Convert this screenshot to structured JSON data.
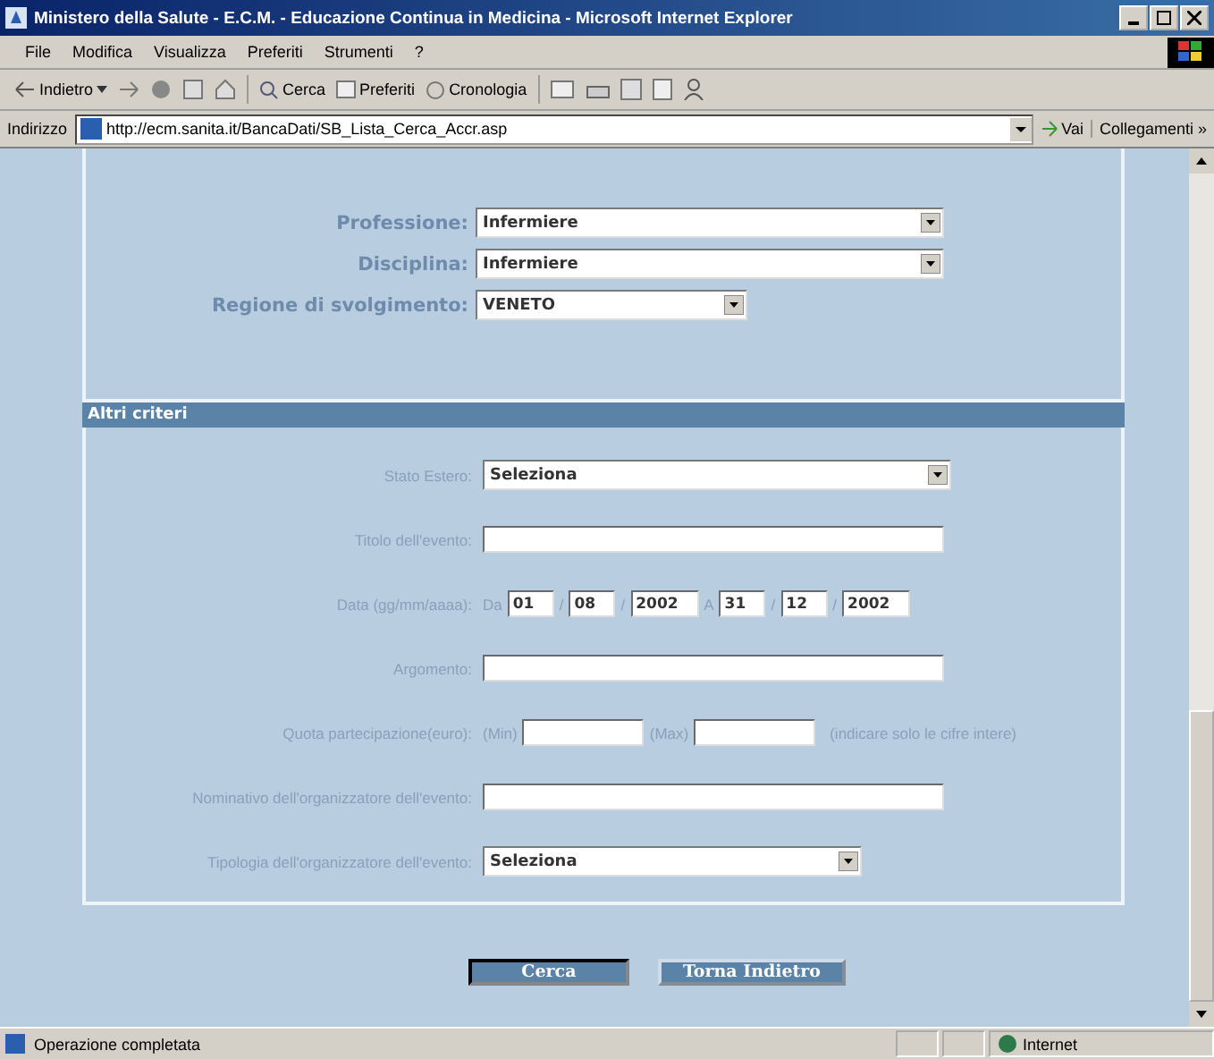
{
  "window": {
    "title": "Ministero della Salute - E.C.M. - Educazione Continua in Medicina - Microsoft Internet Explorer"
  },
  "menu": [
    "File",
    "Modifica",
    "Visualizza",
    "Preferiti",
    "Strumenti",
    "?"
  ],
  "toolbar": {
    "back": "Indietro",
    "search": "Cerca",
    "favorites": "Preferiti",
    "history": "Cronologia"
  },
  "address": {
    "label": "Indirizzo",
    "url": "http://ecm.sanita.it/BancaDati/SB_Lista_Cerca_Accr.asp",
    "go": "Vai",
    "links": "Collegamenti »"
  },
  "main_criteria": [
    {
      "label": "Professione:",
      "value": "Infermiere"
    },
    {
      "label": "Disciplina:",
      "value": "Infermiere"
    },
    {
      "label": "Regione di svolgimento:",
      "value": "VENETO"
    }
  ],
  "section_title": "Altri criteri",
  "other_criteria": [
    {
      "kind": "select",
      "label": "Stato Estero:",
      "value": "Seleziona"
    },
    {
      "kind": "text",
      "label": "Titolo dell'evento:"
    },
    {
      "kind": "date",
      "label": "Data (gg/mm/aaaa):",
      "from_label": "Da",
      "from": [
        "01",
        "08",
        "2002"
      ],
      "to_label": "A",
      "to": [
        "31",
        "12",
        "2002"
      ],
      "separator": "/"
    },
    {
      "kind": "text",
      "label": "Argomento:"
    },
    {
      "kind": "range",
      "label": "Quota partecipazione(euro):",
      "min_label": "(Min)",
      "max_label": "(Max)",
      "note": "(indicare solo le cifre intere)"
    },
    {
      "kind": "text",
      "label": "Nominativo dell'organizzatore dell'evento:"
    },
    {
      "kind": "select",
      "label": "Tipologia dell'organizzatore dell'evento:",
      "value": "Seleziona"
    }
  ],
  "buttons": [
    "Cerca",
    "Torna Indietro"
  ],
  "status_bar": {
    "message": "Operazione completata",
    "zone": "Internet"
  }
}
